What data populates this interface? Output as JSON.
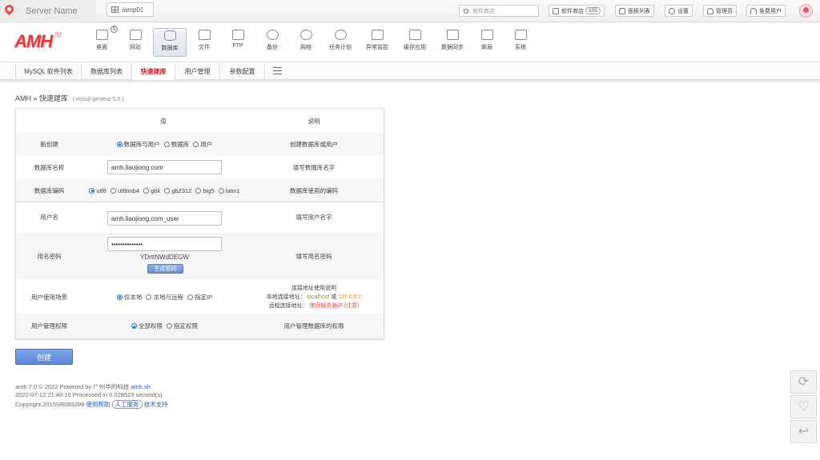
{
  "topbar": {
    "server_name": "Server Name",
    "tab_label": "lamp01",
    "search_placeholder": "软件商店",
    "buttons": [
      {
        "label": "软件商店",
        "badge": "105"
      },
      {
        "label": "面板列表"
      },
      {
        "label": "设置"
      },
      {
        "label": "管理员"
      },
      {
        "label": "免费用户"
      }
    ]
  },
  "nav": {
    "logo": "AMH",
    "logo_version": "7.0",
    "items": [
      {
        "label": "桌面",
        "icon": "home-icon",
        "count": "5"
      },
      {
        "label": "网站",
        "icon": "monitor-icon"
      },
      {
        "label": "数据库",
        "icon": "database-icon"
      },
      {
        "label": "文件",
        "icon": "folder-icon"
      },
      {
        "label": "FTP",
        "icon": "ftp-icon"
      },
      {
        "label": "备份",
        "icon": "backup-icon"
      },
      {
        "label": "网络",
        "icon": "globe-icon"
      },
      {
        "label": "任务计划",
        "icon": "clock-icon"
      },
      {
        "label": "异常监控",
        "icon": "monitor-chart-icon"
      },
      {
        "label": "缓存应用",
        "icon": "cache-icon"
      },
      {
        "label": "数据同步",
        "icon": "sync-icon"
      },
      {
        "label": "邮局",
        "icon": "mail-icon"
      },
      {
        "label": "系统",
        "icon": "system-icon"
      }
    ]
  },
  "subnav": {
    "tabs": [
      "MySQL 软件列表",
      "数据库列表",
      "快速建库",
      "用户管理",
      "参数配置"
    ]
  },
  "breadcrumb": {
    "root": "AMH",
    "sep": "»",
    "page": "快速建库",
    "sub": "( mysql-generic-5.5 )"
  },
  "form": {
    "header_value": "值",
    "header_desc": "说明",
    "create_type": {
      "label": "新创建",
      "options": [
        "数据库与用户",
        "数据库",
        "用户"
      ],
      "desc": "创建数据库或用户"
    },
    "db_name": {
      "label": "数据库名称",
      "value": "amh.liaojiong.com",
      "desc": "填写数据库名字"
    },
    "db_charset": {
      "label": "数据库编码",
      "options": [
        "utf8",
        "utf8mb4",
        "gbk",
        "gb2312",
        "big5",
        "latin1"
      ],
      "desc": "数据库使用的编码"
    },
    "username": {
      "label": "用户名",
      "value": "amh.liaojiong.com_user",
      "desc": "填写用户名字"
    },
    "password": {
      "label": "用名密码",
      "value": "••••••••••••••",
      "generated": "YDrttNWdDEGW",
      "gen_button": "生成密码",
      "desc": "填写用名密码"
    },
    "scene": {
      "label": "用户使用场景",
      "options": [
        "仅本地",
        "本地与远程",
        "指定IP"
      ],
      "desc_title": "连接地址使用说明",
      "local_label": "本地连接地址：",
      "local_host": "localhost",
      "local_or": "或",
      "local_ip": "127.0.0.1",
      "remote_label": "远程连接地址：",
      "remote_value": "使用服务器IP (注意)"
    },
    "privilege": {
      "label": "用户管理权限",
      "options": [
        "全部权限",
        "指定权限"
      ],
      "desc": "用户管理数据库的权限"
    },
    "submit": "创建"
  },
  "footer": {
    "line1_text": "amh 7.0 © 2022 Powered by 广州华的科技",
    "line1_link": "amh.sh",
    "line2": "2022-07-12 21:40:10 Processed in 0.028523 second(s)",
    "line3_text": "Copyright 2015SR085399",
    "help": "使用帮助",
    "service": "人工服务",
    "support": "技术支持"
  }
}
